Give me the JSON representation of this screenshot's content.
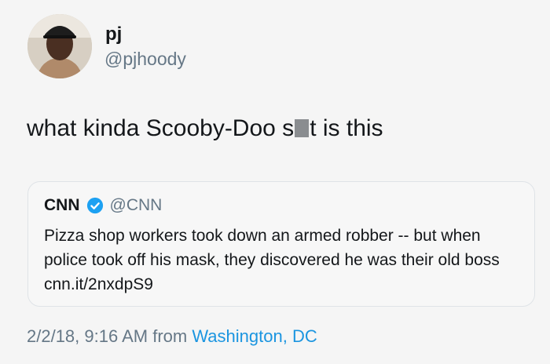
{
  "author": {
    "name": "pj",
    "handle": "@pjhoody"
  },
  "tweet": {
    "text_before": "what kinda Scooby-Doo s",
    "text_after": "t is this"
  },
  "quoted": {
    "name": "CNN",
    "handle": "@CNN",
    "text": "Pizza shop workers took down an armed robber -- but when police took off his mask, they discovered he was their old boss cnn.it/2nxdpS9"
  },
  "meta": {
    "timestamp": "2/2/18, 9:16 AM from",
    "location": "Washington, DC"
  },
  "colors": {
    "link": "#1b95e0",
    "verified": "#1da1f2",
    "secondary_text": "#657786"
  }
}
